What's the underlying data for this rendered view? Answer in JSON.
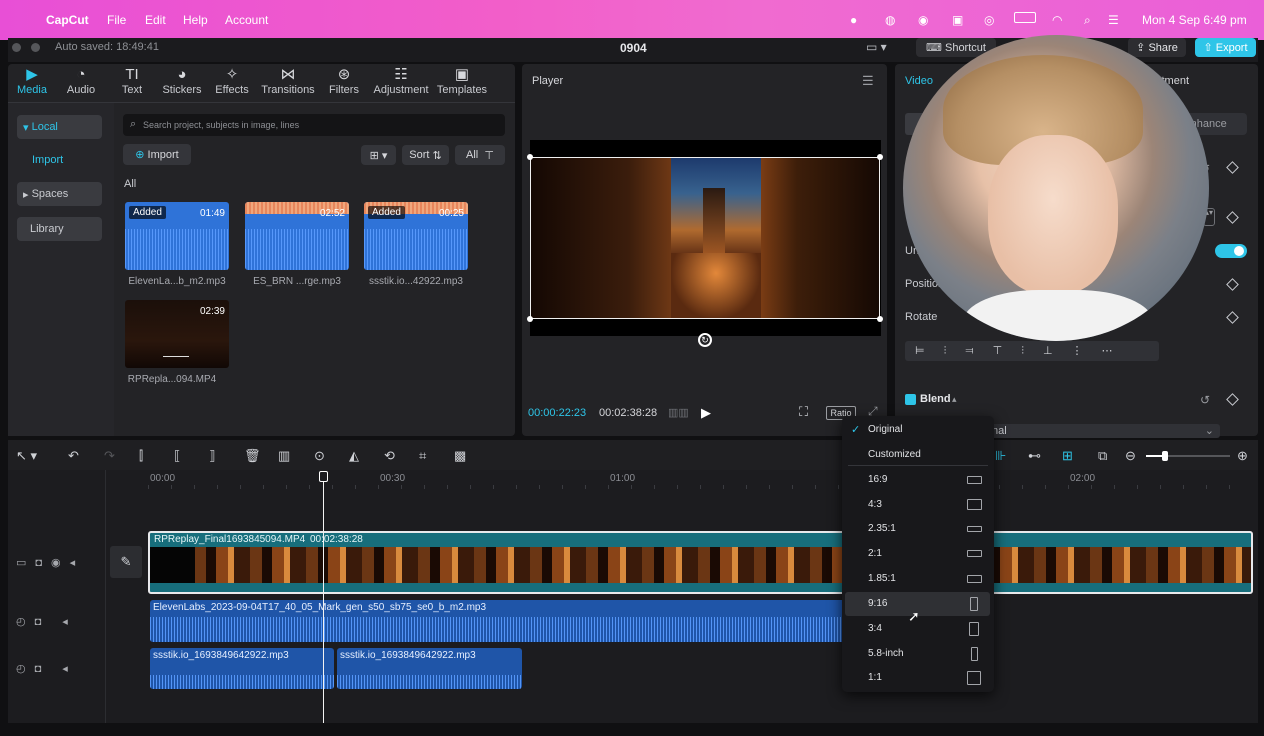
{
  "menubar": {
    "app": "CapCut",
    "items": [
      "File",
      "Edit",
      "Help",
      "Account"
    ],
    "clock": "Mon 4 Sep  6:49 pm"
  },
  "appbar": {
    "autosave": "Auto saved: 18:49:41",
    "project": "0904",
    "shortcut": "Shortcut",
    "share": "Share",
    "export": "Export"
  },
  "media_tabs": [
    {
      "label": "Media",
      "icon": "media-icon"
    },
    {
      "label": "Audio",
      "icon": "audio-icon"
    },
    {
      "label": "Text",
      "icon": "text-icon"
    },
    {
      "label": "Stickers",
      "icon": "stickers-icon"
    },
    {
      "label": "Effects",
      "icon": "effects-icon"
    },
    {
      "label": "Transitions",
      "icon": "transitions-icon"
    },
    {
      "label": "Filters",
      "icon": "filters-icon"
    },
    {
      "label": "Adjustment",
      "icon": "adjustment-icon"
    },
    {
      "label": "Templates",
      "icon": "templates-icon"
    }
  ],
  "sidebar": {
    "local": "Local",
    "import": "Import",
    "spaces": "Spaces",
    "library": "Library"
  },
  "media": {
    "search_placeholder": "Search project, subjects in image, lines",
    "import": "Import",
    "sort": "Sort",
    "all_filter": "All",
    "section": "All",
    "added": "Added",
    "items": [
      {
        "name": "ElevenLa...b_m2.mp3",
        "duration": "01:49"
      },
      {
        "name": "ES_BRN ...rge.mp3",
        "duration": "02:52"
      },
      {
        "name": "ssstik.io...42922.mp3",
        "duration": "00:25"
      },
      {
        "name": "RPRepla...094.MP4",
        "duration": "02:39"
      }
    ]
  },
  "player": {
    "title": "Player",
    "current": "00:00:22:23",
    "total": "00:02:38:28",
    "ratio": "Ratio"
  },
  "inspector": {
    "tab_video": "Video",
    "tab_adjustment_partial": "stment",
    "enhance": "Enhance",
    "uniform_partial": "Uni",
    "position": "Position",
    "rotate": "Rotate",
    "blend": "Blend",
    "blend_mode_partial": "nal"
  },
  "ratio_menu": {
    "selected": "Original",
    "options": [
      "Original",
      "Customized",
      "16:9",
      "4:3",
      "2.35:1",
      "2:1",
      "1.85:1",
      "9:16",
      "3:4",
      "5.8-inch",
      "1:1"
    ]
  },
  "timeline": {
    "ticks": [
      "00:00",
      "00:30",
      "01:00",
      "02:00"
    ],
    "video_clip": {
      "name": "RPReplay_Final1693845094.MP4",
      "duration": "00:02:38:28"
    },
    "audio1": "ElevenLabs_2023-09-04T17_40_05_Mark_gen_s50_sb75_se0_b_m2.mp3",
    "audio2a": "ssstik.io_1693849642922.mp3",
    "audio2b": "ssstik.io_1693849642922.mp3"
  },
  "colors": {
    "accent": "#2ec5e8",
    "menubar": "#ee5bd2",
    "clip": "#2f73d8"
  }
}
